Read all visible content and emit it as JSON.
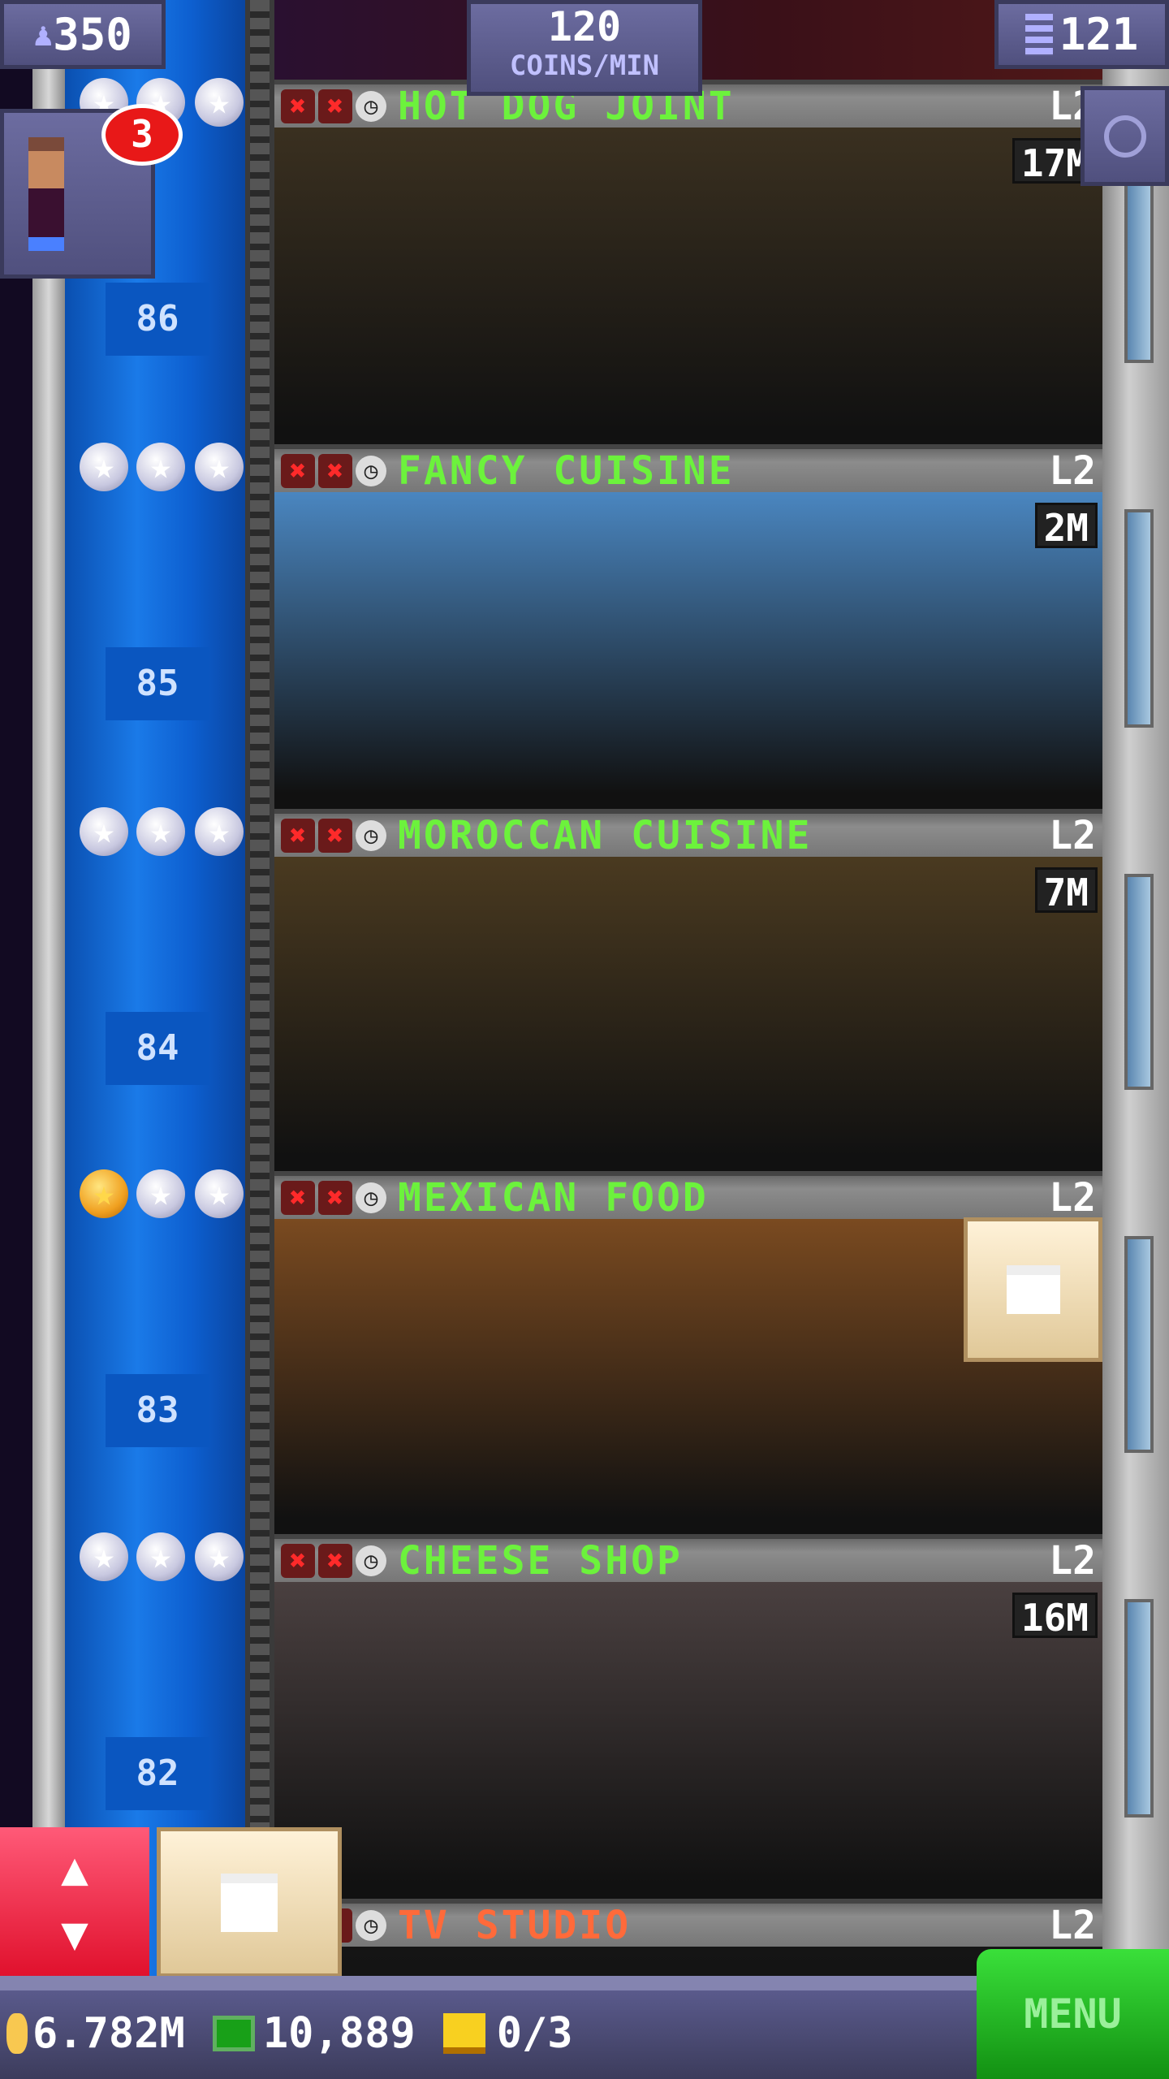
{
  "hud": {
    "population": "350",
    "coins_per_min_value": "120",
    "coins_per_min_label": "COINS/MIN",
    "floor_count": "121",
    "notification_count": "3"
  },
  "floors": [
    {
      "number": "86",
      "name": "HOT DOG JOINT",
      "level": "L2",
      "timer": "17M",
      "gold_stars": 0,
      "name_color": "#6cf23c",
      "scene_color": "#3a3020"
    },
    {
      "number": "85",
      "name": "FANCY CUISINE",
      "level": "L2",
      "timer": "2M",
      "gold_stars": 0,
      "name_color": "#6cf23c",
      "scene_color": "#4a86c0"
    },
    {
      "number": "84",
      "name": "MOROCCAN CUISINE",
      "level": "L2",
      "timer": "7M",
      "gold_stars": 0,
      "name_color": "#6cf23c",
      "scene_color": "#4a3a20"
    },
    {
      "number": "83",
      "name": "MEXICAN FOOD",
      "level": "L2",
      "timer": "",
      "gold_stars": 1,
      "name_color": "#6cf23c",
      "scene_color": "#7a4a20"
    },
    {
      "number": "82",
      "name": "CHEESE SHOP",
      "level": "L2",
      "timer": "16M",
      "gold_stars": 0,
      "name_color": "#6cf23c",
      "scene_color": "#4a4040"
    },
    {
      "number": "",
      "name": "TV STUDIO",
      "level": "L2",
      "timer": "",
      "gold_stars": 0,
      "name_color": "#ff6a3a",
      "scene_color": "#151515"
    }
  ],
  "bottom_bar": {
    "coins": "6.782M",
    "bux": "10,889",
    "tickets": "0/3",
    "menu_label": "MENU"
  },
  "icons": {
    "population": "person-icon",
    "floors": "building-icon",
    "search": "magnifier-icon",
    "elevator": "up-down-arrows-icon",
    "delivery": "bucket-icon"
  },
  "colors": {
    "menu": "#22c022",
    "elevator_button": "#e8203c",
    "hud_panel": "#5c5c8e"
  }
}
